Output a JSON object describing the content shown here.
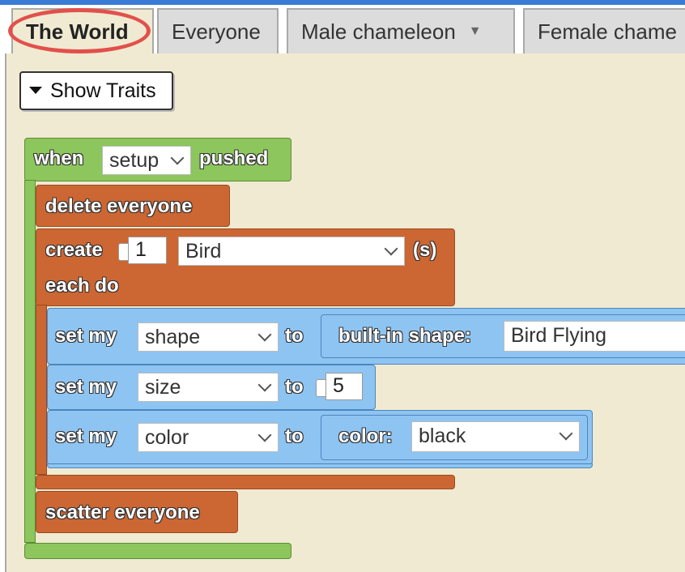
{
  "tabs": [
    {
      "label": "The World",
      "active": true
    },
    {
      "label": "Everyone",
      "active": false
    },
    {
      "label": "Male chameleon",
      "active": false,
      "has_dropdown": true
    },
    {
      "label": "Female chame",
      "active": false
    }
  ],
  "show_traits_label": "Show Traits",
  "blocks": {
    "when_prefix": "when",
    "when_event": "setup",
    "when_suffix": "pushed",
    "delete_label": "delete everyone",
    "create_label": "create",
    "create_count": "1",
    "create_breed": "Bird",
    "create_suffix": "(s)",
    "each_do_label": "each do",
    "set_my_label": "set my",
    "to_label": "to",
    "set_shape": {
      "property": "shape",
      "builtin_label": "built-in shape:",
      "value": "Bird Flying"
    },
    "set_size": {
      "property": "size",
      "value": "5"
    },
    "set_color": {
      "property": "color",
      "color_label": "color:",
      "value": "black"
    },
    "scatter_label": "scatter everyone"
  },
  "colors": {
    "green": "#8cc65d",
    "orange": "#cc6633",
    "blue": "#8ec4f2",
    "highlight": "#e2504b",
    "workspace": "#f0ead2"
  }
}
